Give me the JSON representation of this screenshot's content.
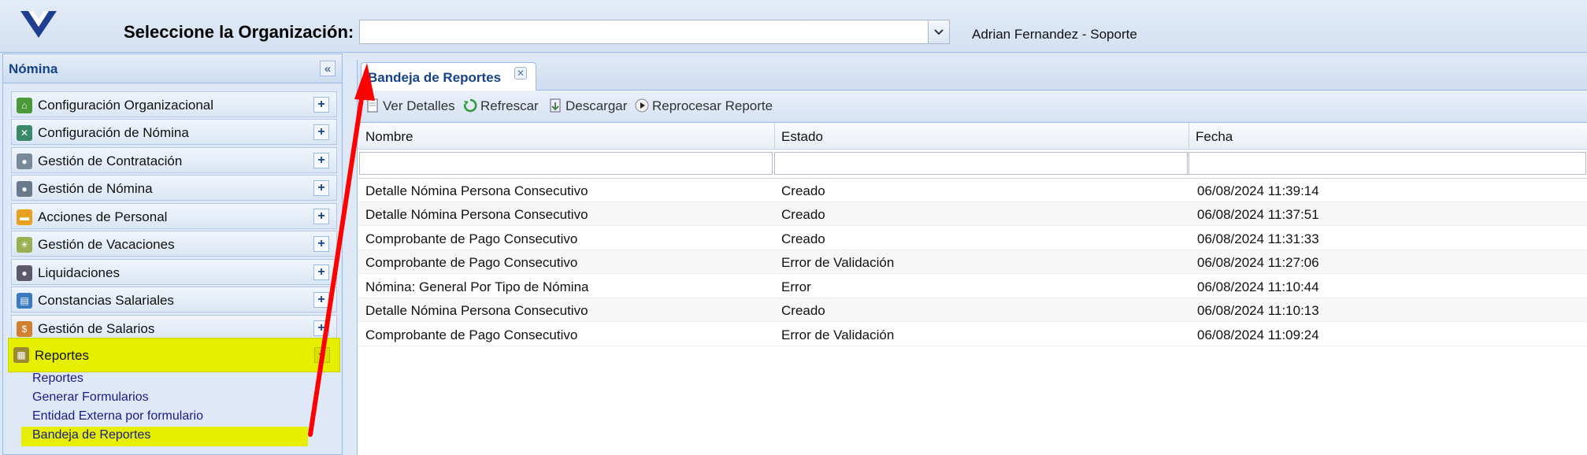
{
  "header": {
    "org_label": "Seleccione la Organización:",
    "org_value": "",
    "user": "Adrian Fernandez - Soporte"
  },
  "sidebar": {
    "title": "Nómina",
    "items": [
      {
        "label": "Configuración Organizacional",
        "icon": "home-icon"
      },
      {
        "label": "Configuración de Nómina",
        "icon": "tools-icon"
      },
      {
        "label": "Gestión de Contratación",
        "icon": "hiring-icon"
      },
      {
        "label": "Gestión de Nómina",
        "icon": "payroll-icon"
      },
      {
        "label": "Acciones de Personal",
        "icon": "folder-icon"
      },
      {
        "label": "Gestión de Vacaciones",
        "icon": "vacation-icon"
      },
      {
        "label": "Liquidaciones",
        "icon": "settlement-icon"
      },
      {
        "label": "Constancias Salariales",
        "icon": "certificate-icon"
      },
      {
        "label": "Gestión de Salarios",
        "icon": "salary-icon"
      },
      {
        "label": "Reportes",
        "icon": "reports-icon"
      }
    ],
    "sub_items": [
      "Reportes",
      "Generar Formularios",
      "Entidad Externa por formulario",
      "Bandeja de Reportes"
    ]
  },
  "tab": {
    "label": "Bandeja de Reportes"
  },
  "toolbar": {
    "view_details": "Ver Detalles",
    "refresh": "Refrescar",
    "download": "Descargar",
    "reprocess": "Reprocesar Reporte"
  },
  "grid": {
    "columns": [
      "Nombre",
      "Estado",
      "Fecha"
    ],
    "rows": [
      {
        "nombre": "Detalle Nómina Persona Consecutivo",
        "estado": "Creado",
        "fecha": "06/08/2024 11:39:14"
      },
      {
        "nombre": "Detalle Nómina Persona Consecutivo",
        "estado": "Creado",
        "fecha": "06/08/2024 11:37:51"
      },
      {
        "nombre": "Comprobante de Pago Consecutivo",
        "estado": "Creado",
        "fecha": "06/08/2024 11:31:33"
      },
      {
        "nombre": "Comprobante de Pago Consecutivo",
        "estado": "Error de Validación",
        "fecha": "06/08/2024 11:27:06"
      },
      {
        "nombre": "Nómina: General Por Tipo de Nómina",
        "estado": "Error",
        "fecha": "06/08/2024 11:10:44"
      },
      {
        "nombre": "Detalle Nómina Persona Consecutivo",
        "estado": "Creado",
        "fecha": "06/08/2024 11:10:13"
      },
      {
        "nombre": "Comprobante de Pago Consecutivo",
        "estado": "Error de Validación",
        "fecha": "06/08/2024 11:09:24"
      }
    ]
  },
  "colors": {
    "highlight": "#e6ef00",
    "title_blue": "#15428b",
    "arrow_red": "#ff0000"
  }
}
